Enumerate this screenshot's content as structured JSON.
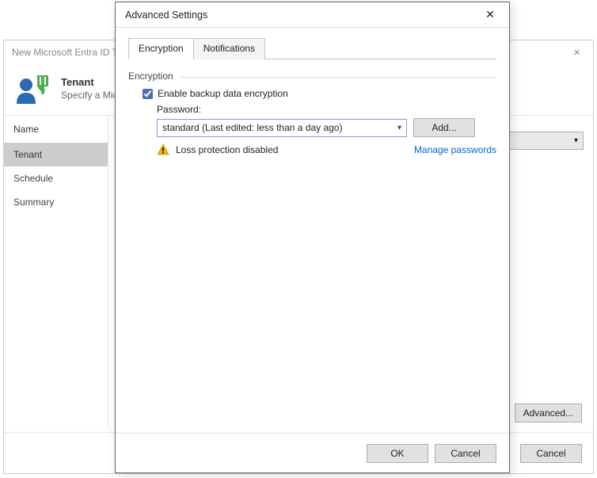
{
  "wizard": {
    "title": "New Microsoft Entra ID Te",
    "header_title": "Tenant",
    "header_sub": "Specify a Mic",
    "side_head": "Name",
    "steps": [
      "Tenant",
      "Schedule",
      "Summary"
    ],
    "active_step": 0,
    "btn_advanced": "Advanced...",
    "btn_cancel": "Cancel"
  },
  "modal": {
    "title": "Advanced Settings",
    "tabs": [
      "Encryption",
      "Notifications"
    ],
    "active_tab": 0,
    "group_title": "Encryption",
    "enable_label": "Enable backup data encryption",
    "enable_checked": true,
    "password_label": "Password:",
    "password_selected": "standard (Last edited: less than a day ago)",
    "btn_add": "Add...",
    "warn_text": "Loss protection disabled",
    "link_manage": "Manage passwords",
    "btn_ok": "OK",
    "btn_cancel": "Cancel"
  }
}
